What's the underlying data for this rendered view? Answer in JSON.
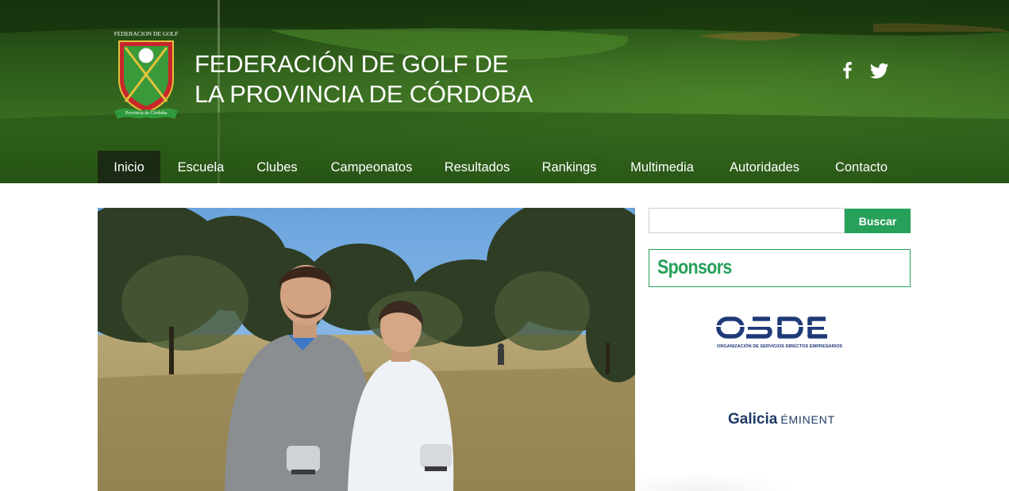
{
  "header": {
    "title_line1": "FEDERACIÓN DE GOLF DE",
    "title_line2": "LA PROVINCIA DE CÓRDOBA",
    "logo": {
      "top_text": "FEDERACION DE GOLF",
      "ribbon_text": "Provincia de Córdoba",
      "colors": {
        "shield_red": "#c8262b",
        "shield_green": "#3a9a3a",
        "gold": "#e2c23a"
      }
    },
    "social": [
      {
        "icon": "facebook-icon",
        "label": "f"
      },
      {
        "icon": "twitter-icon",
        "label": "twitter"
      }
    ]
  },
  "nav": {
    "items": [
      {
        "label": "Inicio",
        "active": true
      },
      {
        "label": "Escuela",
        "active": false
      },
      {
        "label": "Clubes",
        "active": false
      },
      {
        "label": "Campeonatos",
        "active": false
      },
      {
        "label": "Resultados",
        "active": false
      },
      {
        "label": "Rankings",
        "active": false
      },
      {
        "label": "Multimedia",
        "active": false
      },
      {
        "label": "Autoridades",
        "active": false
      },
      {
        "label": "Contacto",
        "active": false
      }
    ]
  },
  "hero": {
    "alt": "Two golfers holding trophies on a golf course"
  },
  "sidebar": {
    "search": {
      "value": "",
      "placeholder": "",
      "button_label": "Buscar"
    },
    "sponsors_title": "Sponsors",
    "sponsors": [
      {
        "name": "OSDE",
        "tagline": "ORGANIZACIÓN DE SERVICIOS DIRECTOS EMPRESARIOS"
      },
      {
        "name": "Galicia",
        "tier": "ÉMINENT"
      }
    ]
  },
  "colors": {
    "accent_green": "#27a05a",
    "nav_active": "#1b2a12",
    "brand_blue": "#1f3a66"
  }
}
